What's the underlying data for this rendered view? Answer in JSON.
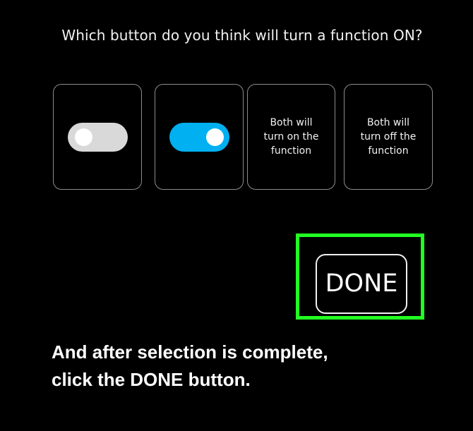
{
  "question": "Which button do you think will turn a function ON?",
  "options": [
    {
      "type": "toggle",
      "icon": "toggle-off-icon",
      "state": "off",
      "track_color": "#d9d9d9"
    },
    {
      "type": "toggle",
      "icon": "toggle-on-icon",
      "state": "on",
      "track_color": "#00b0f0"
    },
    {
      "type": "text",
      "lines": [
        "Both will",
        "turn on the",
        "function"
      ]
    },
    {
      "type": "text",
      "lines": [
        "Both will",
        "turn off the",
        "function"
      ]
    }
  ],
  "done_button": {
    "label": "DONE",
    "highlight_color": "#22ff22"
  },
  "instruction": {
    "lines": [
      "And after selection is complete,",
      "click the DONE button."
    ]
  }
}
